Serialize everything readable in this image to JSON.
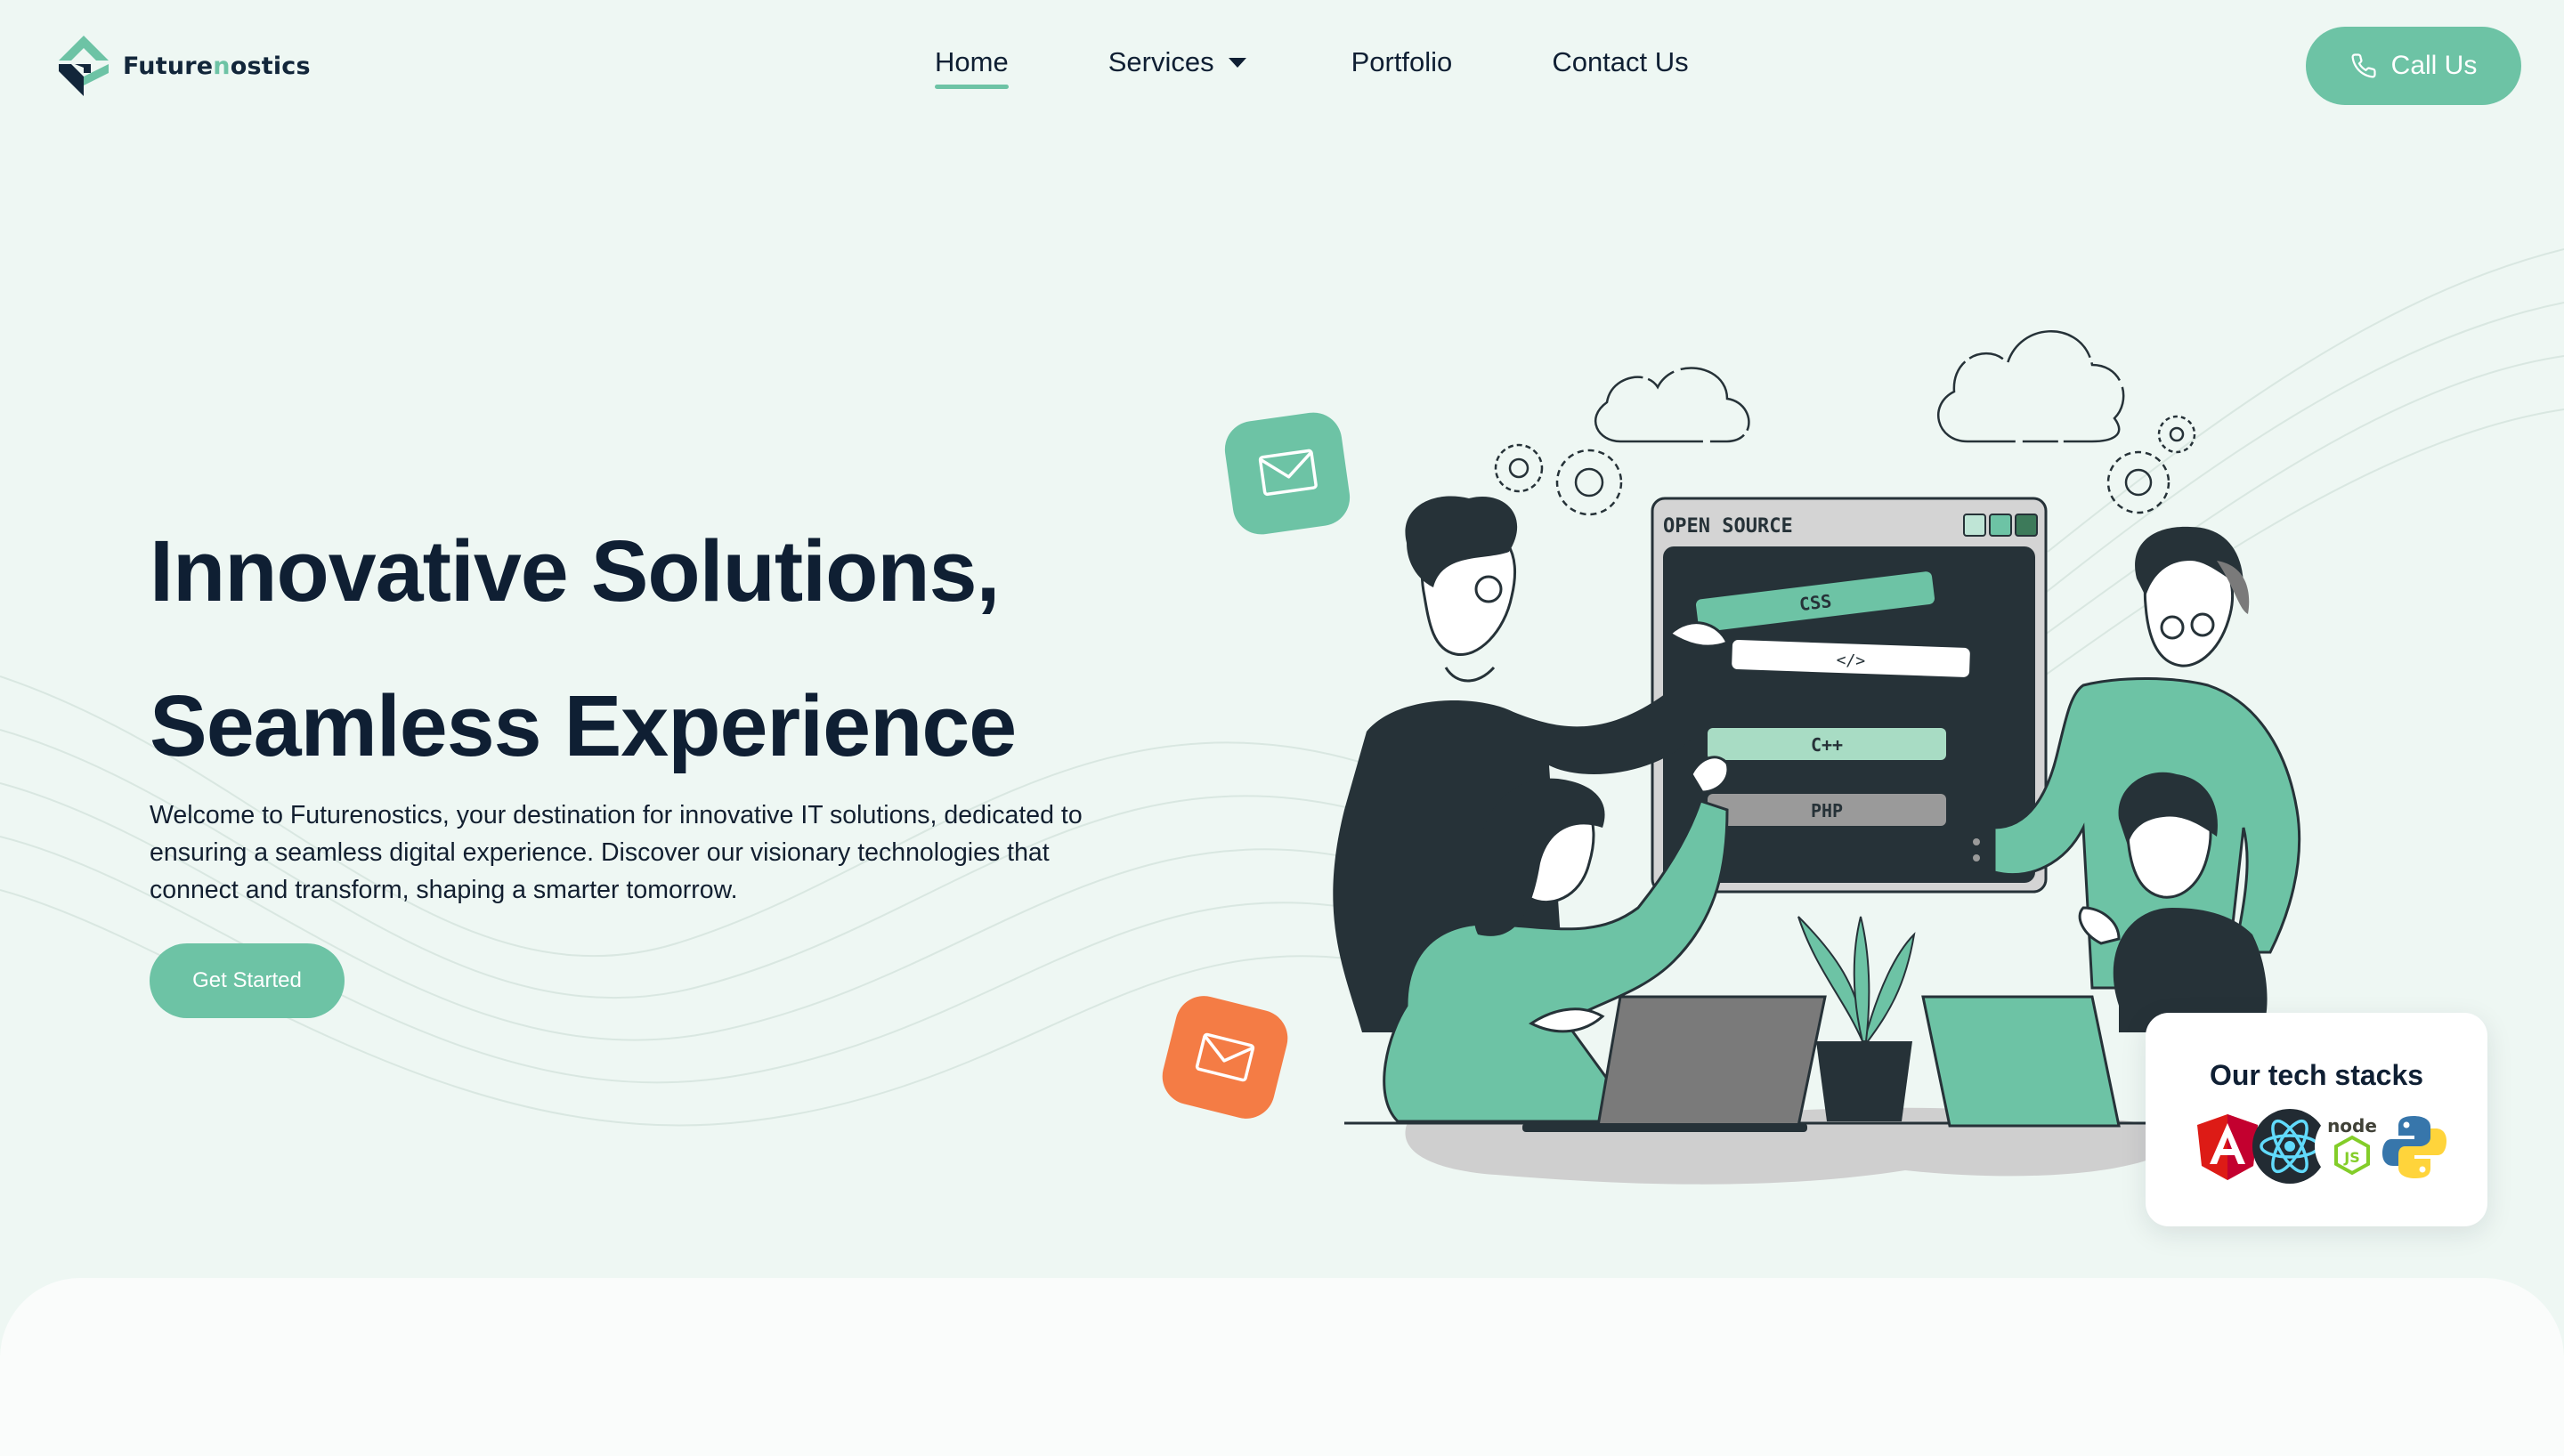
{
  "brand": {
    "name_part1": "Future",
    "name_accent": "n",
    "name_part2": "ostics",
    "logo_icon": "futurenostics-logo"
  },
  "nav": {
    "items": [
      {
        "label": "Home",
        "active": true
      },
      {
        "label": "Services",
        "icon": "caret-down-icon"
      },
      {
        "label": "Portfolio"
      },
      {
        "label": "Contact Us"
      }
    ]
  },
  "header": {
    "call_label": "Call Us",
    "call_icon": "phone-icon"
  },
  "hero": {
    "title_line1": "Innovative Solutions,",
    "title_line2": "Seamless Experience",
    "description": "Welcome to Futurenostics, your destination for innovative IT solutions, dedicated to ensuring a seamless digital experience. Discover our visionary technologies that connect and transform, shaping a smarter tomorrow.",
    "cta_label": "Get Started"
  },
  "illustration": {
    "window_title": "OPEN SOURCE",
    "bar_css": "CSS",
    "bar_code": "</>",
    "bar_cpp": "C++",
    "bar_php": "PHP"
  },
  "tech_stacks": {
    "title": "Our tech stacks",
    "logos": [
      "angular-icon",
      "react-icon",
      "nodejs-icon",
      "python-icon"
    ],
    "node_text": "node",
    "node_js": "JS"
  },
  "colors": {
    "background": "#eef7f3",
    "accent": "#6dc3a5",
    "heading": "#0f1f33",
    "mail_badge_orange": "#f47c45",
    "dark": "#263238"
  }
}
